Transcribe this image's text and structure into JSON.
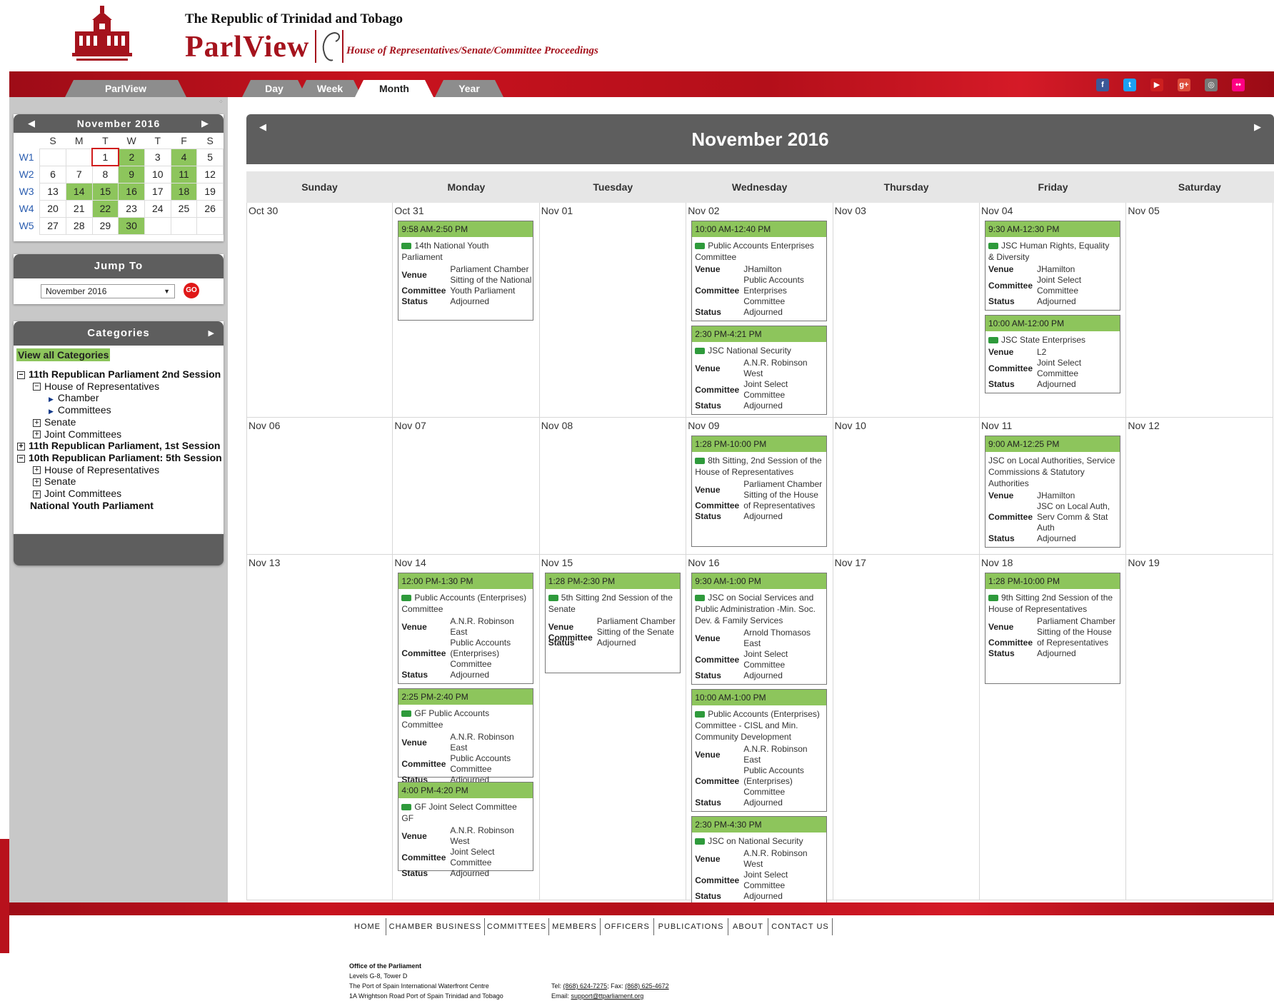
{
  "header": {
    "republic": "The Republic of Trinidad and Tobago",
    "brand": "ParlView",
    "subtitle": "House of Representatives/Senate/Committee Proceedings"
  },
  "nav": {
    "tabs": [
      {
        "label": "ParlView"
      },
      {
        "label": "Day"
      },
      {
        "label": "Week"
      },
      {
        "label": "Month"
      },
      {
        "label": "Year"
      }
    ],
    "active": "Month"
  },
  "social": [
    {
      "name": "facebook-icon",
      "glyph": "f",
      "color": "#3b5998"
    },
    {
      "name": "twitter-icon",
      "glyph": "t",
      "color": "#1da1f2"
    },
    {
      "name": "youtube-icon",
      "glyph": "▶",
      "color": "#cc1f1f"
    },
    {
      "name": "googleplus-icon",
      "glyph": "g+",
      "color": "#dd4b39"
    },
    {
      "name": "instagram-icon",
      "glyph": "◎",
      "color": "#777"
    },
    {
      "name": "flickr-icon",
      "glyph": "••",
      "color": "#ff0084"
    }
  ],
  "mini_calendar": {
    "title": "November 2016",
    "days": [
      "S",
      "M",
      "T",
      "W",
      "T",
      "F",
      "S"
    ],
    "weeks": [
      {
        "label": "W1",
        "days": [
          "",
          "",
          "1",
          "2",
          "3",
          "4",
          "5"
        ],
        "events": [
          3,
          5
        ]
      },
      {
        "label": "W2",
        "days": [
          "6",
          "7",
          "8",
          "9",
          "10",
          "11",
          "12"
        ],
        "events": [
          3,
          5
        ]
      },
      {
        "label": "W3",
        "days": [
          "13",
          "14",
          "15",
          "16",
          "17",
          "18",
          "19"
        ],
        "events": [
          1,
          2,
          3,
          5
        ]
      },
      {
        "label": "W4",
        "days": [
          "20",
          "21",
          "22",
          "23",
          "24",
          "25",
          "26"
        ],
        "events": [
          2
        ]
      },
      {
        "label": "W5",
        "days": [
          "27",
          "28",
          "29",
          "30",
          "",
          "",
          ""
        ],
        "events": [
          3
        ]
      }
    ],
    "today": "1"
  },
  "jump": {
    "title": "Jump To",
    "value": "November 2016",
    "go": "GO"
  },
  "categories": {
    "title": "Categories",
    "view_all": "View all Categories",
    "items": [
      {
        "label": "11th Republican Parliament 2nd Session",
        "level": 0,
        "marker": "−",
        "bold": true
      },
      {
        "label": "House of Representatives",
        "level": 1,
        "marker": "−",
        "bold": false
      },
      {
        "label": "Chamber",
        "level": 2,
        "marker": "tri",
        "bold": false
      },
      {
        "label": "Committees",
        "level": 2,
        "marker": "tri",
        "bold": false
      },
      {
        "label": "Senate",
        "level": 1,
        "marker": "+",
        "bold": false
      },
      {
        "label": "Joint Committees",
        "level": 1,
        "marker": "+",
        "bold": false
      },
      {
        "label": "11th Republican Parliament, 1st Session",
        "level": 0,
        "marker": "+",
        "bold": true
      },
      {
        "label": "10th Republican Parliament: 5th Session",
        "level": 0,
        "marker": "−",
        "bold": true
      },
      {
        "label": "House of Representatives",
        "level": 1,
        "marker": "+",
        "bold": false
      },
      {
        "label": "Senate",
        "level": 1,
        "marker": "+",
        "bold": false
      },
      {
        "label": "Joint Committees",
        "level": 1,
        "marker": "+",
        "bold": false
      },
      {
        "label": "National Youth Parliament",
        "level": 0,
        "marker": "",
        "bold": true
      }
    ]
  },
  "calendar": {
    "title": "November 2016",
    "day_names": [
      "Sunday",
      "Monday",
      "Tuesday",
      "Wednesday",
      "Thursday",
      "Friday",
      "Saturday"
    ],
    "labels": {
      "venue": "Venue",
      "committee": "Committee",
      "status": "Status"
    },
    "weeks": [
      {
        "dates": [
          "Oct 30",
          "Oct 31",
          "Nov 01",
          "Nov 02",
          "Nov 03",
          "Nov 04",
          "Nov 05"
        ],
        "events": {
          "1": [
            {
              "time": "9:58 AM-2:50 PM",
              "title": "14th National Youth Parliament",
              "cam": true,
              "venue": "Parliament Chamber",
              "committee": "Sitting of the National Youth Parliament",
              "status": "Adjourned"
            }
          ],
          "3": [
            {
              "time": "10:00 AM-12:40 PM",
              "title": "Public Accounts Enterprises Committee",
              "cam": true,
              "venue": "JHamilton",
              "committee": "Public Accounts Enterprises Committee",
              "status": "Adjourned"
            },
            {
              "time": "2:30 PM-4:21 PM",
              "title": "JSC National Security",
              "cam": true,
              "venue": "A.N.R. Robinson West",
              "committee": "Joint Select Committee",
              "status": "Adjourned"
            }
          ],
          "5": [
            {
              "time": "9:30 AM-12:30 PM",
              "title": "JSC Human Rights, Equality & Diversity",
              "cam": true,
              "venue": "JHamilton",
              "committee": "Joint Select Committee",
              "status": "Adjourned"
            },
            {
              "time": "10:00 AM-12:00 PM",
              "title": "JSC State Enterprises",
              "cam": true,
              "venue": "L2",
              "committee": "Joint Select Committee",
              "status": "Adjourned"
            }
          ]
        }
      },
      {
        "dates": [
          "Nov 06",
          "Nov 07",
          "Nov 08",
          "Nov 09",
          "Nov 10",
          "Nov 11",
          "Nov 12"
        ],
        "events": {
          "3": [
            {
              "time": "1:28 PM-10:00 PM",
              "title": "8th Sitting, 2nd Session of the House of Representatives",
              "cam": true,
              "venue": "Parliament Chamber",
              "committee": "Sitting of the House of Representatives",
              "status": "Adjourned"
            }
          ],
          "5": [
            {
              "time": "9:00 AM-12:25 PM",
              "title": "JSC on Local Authorities, Service Commissions & Statutory Authorities",
              "cam": false,
              "venue": "JHamilton",
              "committee": "JSC on Local Auth, Serv Comm & Stat Auth",
              "status": "Adjourned"
            }
          ]
        }
      },
      {
        "dates": [
          "Nov 13",
          "Nov 14",
          "Nov 15",
          "Nov 16",
          "Nov 17",
          "Nov 18",
          "Nov 19"
        ],
        "events": {
          "1": [
            {
              "time": "12:00 PM-1:30 PM",
              "title": "Public Accounts (Enterprises) Committee",
              "cam": true,
              "venue": "A.N.R. Robinson East",
              "committee": "Public Accounts (Enterprises) Committee",
              "status": "Adjourned"
            },
            {
              "time": "2:25 PM-2:40 PM",
              "title": "GF Public Accounts Committee",
              "cam": true,
              "venue": "A.N.R. Robinson East",
              "committee": "Public Accounts Committee",
              "status": "Adjourned"
            },
            {
              "time": "4:00 PM-4:20 PM",
              "title": "GF Joint Select Committee GF",
              "cam": true,
              "venue": "A.N.R. Robinson West",
              "committee": "Joint Select Committee",
              "status": "Adjourned"
            }
          ],
          "2": [
            {
              "time": "1:28 PM-2:30 PM",
              "title": "5th Sitting 2nd Session of the Senate",
              "cam": true,
              "venue": "Parliament Chamber",
              "committee": "Sitting of the Senate",
              "status": "Adjourned"
            }
          ],
          "3": [
            {
              "time": "9:30 AM-1:00 PM",
              "title": "JSC on Social Services and Public Administration -Min. Soc. Dev. & Family Services",
              "cam": true,
              "venue": "Arnold Thomasos East",
              "committee": "Joint Select Committee",
              "status": "Adjourned"
            },
            {
              "time": "10:00 AM-1:00 PM",
              "title": "Public Accounts (Enterprises) Committee - CISL and Min. Community Development",
              "cam": true,
              "venue": "A.N.R. Robinson East",
              "committee": "Public Accounts (Enterprises) Committee",
              "status": "Adjourned"
            },
            {
              "time": "2:30 PM-4:30 PM",
              "title": "JSC on National Security",
              "cam": true,
              "venue": "A.N.R. Robinson West",
              "committee": "Joint Select Committee",
              "status": "Adjourned"
            }
          ],
          "5": [
            {
              "time": "1:28 PM-10:00 PM",
              "title": "9th Sitting 2nd Session of the House of Representatives",
              "cam": true,
              "venue": "Parliament Chamber",
              "committee": "Sitting of the House of Representatives",
              "status": "Adjourned"
            }
          ]
        }
      }
    ]
  },
  "footer": {
    "nav": [
      "HOME",
      "CHAMBER BUSINESS",
      "COMMITTEES",
      "MEMBERS",
      "OFFICERS",
      "PUBLICATIONS",
      "ABOUT",
      "CONTACT US"
    ],
    "office": "Office of the Parliament",
    "addr1": "Levels G-8, Tower D",
    "addr2": "The Port of Spain International Waterfront Centre",
    "addr3": "1A Wrightson Road Port of Spain Trinidad and Tobago",
    "tel_label": "Tel:",
    "tel": "(868) 624-7275",
    "fax_label": "; Fax:",
    "fax": "(868) 625-4672",
    "email_label": "Email:",
    "email": "support@ttparliament.org"
  }
}
